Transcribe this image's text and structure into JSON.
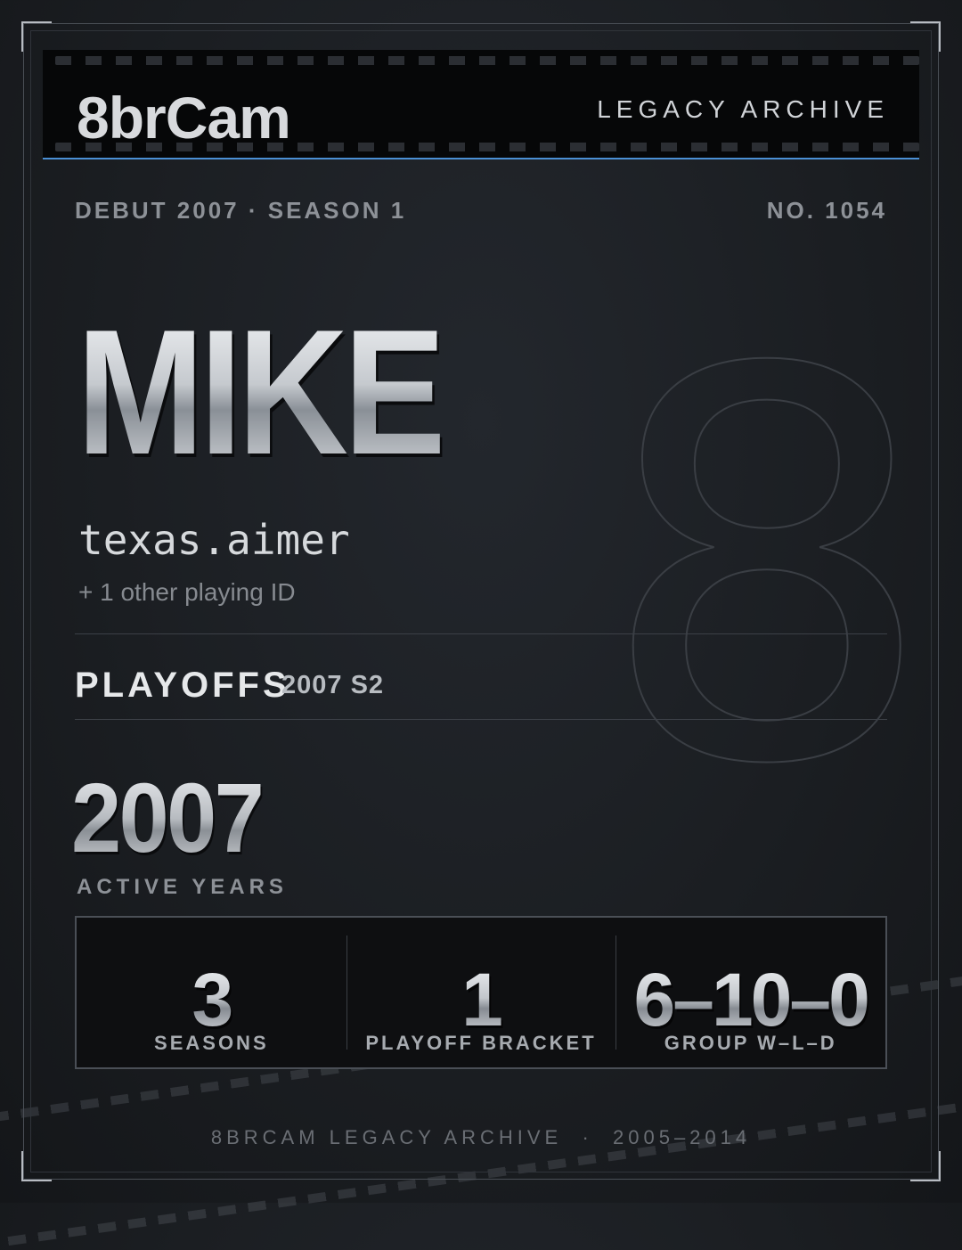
{
  "header": {
    "brand": "8brCam",
    "archive_tag": "LEGACY ARCHIVE"
  },
  "meta": {
    "debut": "DEBUT 2007 · SEASON 1",
    "number": "NO. 1054"
  },
  "player": {
    "name": "MIKE",
    "handle": "texas.aimer",
    "other_ids": "+ 1 other playing ID",
    "background_numeral": "8"
  },
  "playoffs": {
    "label": "PLAYOFFS",
    "season": "2007 S2"
  },
  "active": {
    "years": "2007",
    "label": "ACTIVE YEARS"
  },
  "stats": [
    {
      "value": "3",
      "label": "SEASONS"
    },
    {
      "value": "1",
      "label": "PLAYOFF BRACKET"
    },
    {
      "value": "6–10–0",
      "label": "GROUP W–L–D"
    }
  ],
  "footer": {
    "text": "8BRCAM LEGACY ARCHIVE  ·  2005–2014"
  },
  "colors": {
    "accent": "#4a8fd4",
    "background": "#1b1e22",
    "header_bg": "#060708"
  }
}
